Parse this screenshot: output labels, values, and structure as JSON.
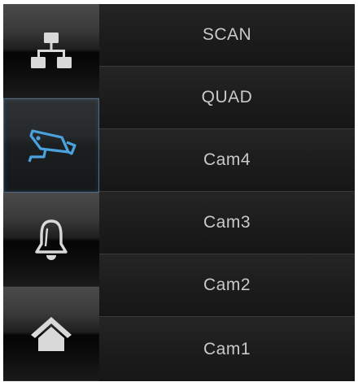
{
  "sidebar": {
    "buttons": [
      {
        "icon": "network-icon",
        "active": false
      },
      {
        "icon": "camera-icon",
        "active": true
      },
      {
        "icon": "bell-icon",
        "active": false
      },
      {
        "icon": "home-icon",
        "active": false
      }
    ]
  },
  "channel_list": {
    "items": [
      "SCAN",
      "QUAD",
      "Cam4",
      "Cam3",
      "Cam2",
      "Cam1"
    ]
  },
  "colors": {
    "icon": "#d9d9d9",
    "icon_active": "#4aa3df",
    "text": "#c9c9c9",
    "active_border": "#4f6d86"
  }
}
